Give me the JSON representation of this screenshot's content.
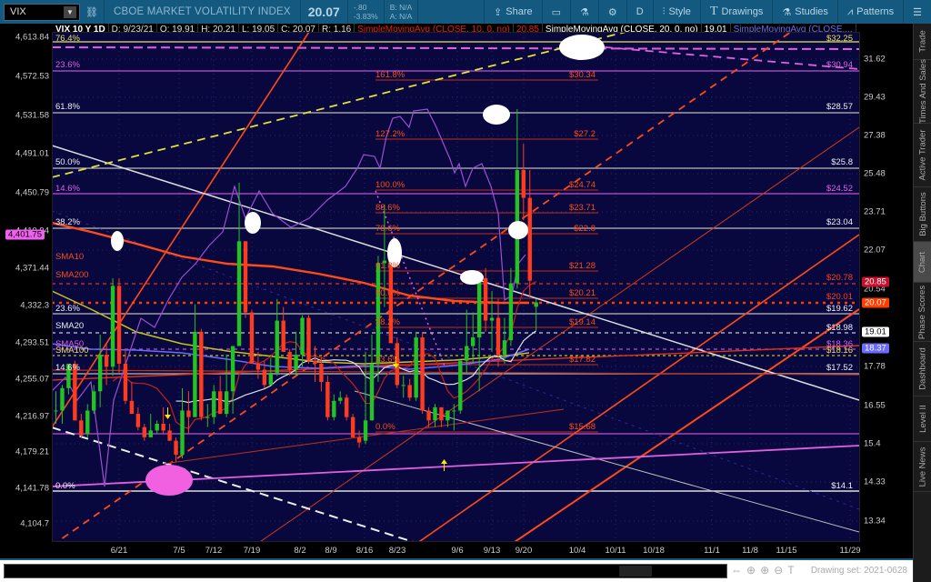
{
  "toolbar": {
    "symbol": "VIX",
    "title": "CBOE MARKET VOLATILITY INDEX",
    "last": "20.07",
    "change": "-.80",
    "change_pct": "-3.83%",
    "bid": "B: N/A",
    "ask": "A: N/A",
    "share": "Share",
    "period": "D",
    "style": "Style",
    "drawings": "Drawings",
    "studies": "Studies",
    "patterns": "Patterns"
  },
  "infobar": {
    "symbol_period": "VIX 10 Y 1D",
    "date": "D: 9/23/21",
    "open": "O: 19.91",
    "high": "H: 20.21",
    "low": "L: 19.05",
    "close": "C: 20.07",
    "range": "R: 1.16",
    "sma10_label": "SimpleMovingAvg (CLOSE, 10, 0, no)",
    "sma10_value": "20.85",
    "sma20_label": "SimpleMovingAvg (CLOSE, 20, 0, no)",
    "sma20_value": "19.01",
    "sma_other_label": "SimpleMovingAvg (CLOSE,..."
  },
  "left_axis": {
    "ticks": [
      "4,613.84",
      "4,572.53",
      "4,531.58",
      "4,491.01",
      "4,450.79",
      "4,410.94",
      "4,371.44",
      "4,332.3",
      "4,293.51",
      "4,255.07",
      "4,216.97",
      "4,179.21",
      "4,141.78",
      "4,104.7"
    ],
    "badge": "4,401.75"
  },
  "right_axis": {
    "ticks": [
      "31.62",
      "29.43",
      "27.38",
      "25.48",
      "23.71",
      "22.07",
      "20.54",
      "17.78",
      "16.55",
      "15.4",
      "14.33",
      "13.34"
    ],
    "badges": [
      {
        "value": "20.85",
        "color": "#c8102e"
      },
      {
        "value": "20.07",
        "color": "#ff3d00"
      },
      {
        "value": "19.01",
        "color": "#ffffff"
      },
      {
        "value": "18.37",
        "color": "#6a6aff"
      }
    ]
  },
  "left_fib_labels": [
    "76.4%",
    "23.6%",
    "61.8%",
    "50.0%",
    "14.6%",
    "38.2%",
    "SMA10",
    "SMA200",
    "23.6%",
    "SMA20",
    "SMA50",
    "SMA100",
    "14.6%",
    "0.0%"
  ],
  "mid_fib": {
    "pct": [
      "161.8%",
      "127.2%",
      "100.0%",
      "88.6%",
      "78.6%",
      "61.8%",
      "50.0%",
      "38.2%",
      "23.6%",
      "0.0%"
    ],
    "price": [
      "$30.34",
      "$27.2",
      "$24.74",
      "$23.71",
      "$22.8",
      "$21.28",
      "$20.21",
      "$19.14",
      "$17.82",
      "$15.68"
    ]
  },
  "right_levels": [
    "$32.25",
    "$30.94",
    "$28.57",
    "$25.8",
    "$24.52",
    "$23.04",
    "$20.78",
    "$20.01",
    "$19.62",
    "$18.98",
    "$18.36",
    "$18.16",
    "$17.52",
    "$14.1"
  ],
  "sidebar": {
    "tabs": [
      "Trade",
      "Times And Sales",
      "Active Trader",
      "Big Buttons",
      "Chart",
      "Phase Scores",
      "Dashboard",
      "Level II",
      "Live News"
    ],
    "active": "Chart"
  },
  "bottom": {
    "drawing_set": "Drawing set: 2021-0628"
  },
  "chart_data": {
    "type": "candlestick",
    "symbol": "VIX",
    "scale": "log",
    "ylim": [
      13.0,
      32.5
    ],
    "x_tick_labels": [
      "6/21",
      "7/5",
      "7/12",
      "7/19",
      "8/2",
      "8/9",
      "8/16",
      "8/23",
      "9/6",
      "9/13",
      "9/20",
      "10/4",
      "10/11",
      "10/18",
      "11/1",
      "11/8",
      "11/15",
      "11/29"
    ],
    "dates": [
      "6/7",
      "6/8",
      "6/9",
      "6/10",
      "6/11",
      "6/14",
      "6/15",
      "6/16",
      "6/17",
      "6/18",
      "6/21",
      "6/22",
      "6/23",
      "6/24",
      "6/25",
      "6/28",
      "6/29",
      "6/30",
      "7/1",
      "7/2",
      "7/6",
      "7/7",
      "7/8",
      "7/9",
      "7/12",
      "7/13",
      "7/14",
      "7/15",
      "7/16",
      "7/19",
      "7/20",
      "7/21",
      "7/22",
      "7/23",
      "7/26",
      "7/27",
      "7/28",
      "7/29",
      "7/30",
      "8/2",
      "8/3",
      "8/4",
      "8/5",
      "8/6",
      "8/9",
      "8/10",
      "8/11",
      "8/12",
      "8/13",
      "8/16",
      "8/17",
      "8/18",
      "8/19",
      "8/20",
      "8/23",
      "8/24",
      "8/25",
      "8/26",
      "8/27",
      "8/30",
      "8/31",
      "9/1",
      "9/2",
      "9/3",
      "9/7",
      "9/8",
      "9/9",
      "9/10",
      "9/13",
      "9/14",
      "9/15",
      "9/16",
      "9/17",
      "9/20",
      "9/21",
      "9/22",
      "9/23"
    ],
    "ohlc": [
      [
        16.4,
        17.0,
        16.0,
        16.4
      ],
      [
        16.4,
        17.2,
        16.0,
        17.1
      ],
      [
        17.1,
        17.9,
        16.9,
        17.9
      ],
      [
        17.9,
        18.0,
        16.1,
        16.1
      ],
      [
        16.1,
        16.3,
        15.6,
        15.65
      ],
      [
        15.7,
        16.6,
        15.6,
        16.4
      ],
      [
        16.4,
        17.2,
        16.3,
        17.0
      ],
      [
        17.0,
        18.9,
        16.5,
        18.2
      ],
      [
        18.2,
        18.6,
        17.2,
        17.8
      ],
      [
        17.8,
        21.0,
        17.5,
        20.7
      ],
      [
        20.7,
        21.0,
        17.6,
        17.9
      ],
      [
        17.9,
        18.4,
        16.6,
        16.7
      ],
      [
        16.7,
        17.3,
        16.3,
        16.3
      ],
      [
        16.3,
        16.5,
        15.8,
        15.9
      ],
      [
        15.9,
        16.0,
        15.5,
        15.6
      ],
      [
        15.6,
        16.3,
        15.6,
        15.8
      ],
      [
        15.8,
        16.1,
        15.7,
        16.0
      ],
      [
        16.0,
        16.5,
        15.7,
        15.8
      ],
      [
        15.8,
        16.0,
        15.5,
        15.5
      ],
      [
        15.5,
        15.6,
        14.9,
        15.1
      ],
      [
        15.1,
        17.1,
        15.0,
        16.4
      ],
      [
        16.4,
        17.0,
        15.7,
        16.2
      ],
      [
        16.2,
        20.0,
        16.2,
        19.0
      ],
      [
        19.0,
        19.1,
        16.1,
        16.2
      ],
      [
        16.2,
        16.6,
        15.9,
        16.2
      ],
      [
        16.2,
        17.2,
        16.0,
        17.0
      ],
      [
        17.0,
        17.5,
        16.3,
        16.3
      ],
      [
        16.3,
        18.2,
        16.2,
        17.0
      ],
      [
        17.0,
        18.5,
        16.3,
        18.5
      ],
      [
        18.5,
        25.1,
        18.5,
        22.5
      ],
      [
        22.5,
        22.5,
        19.5,
        19.7
      ],
      [
        19.7,
        19.8,
        17.9,
        17.9
      ],
      [
        17.9,
        18.3,
        17.4,
        17.7
      ],
      [
        17.7,
        18.0,
        17.1,
        17.2
      ],
      [
        17.2,
        18.1,
        17.2,
        17.6
      ],
      [
        17.6,
        20.2,
        17.5,
        19.4
      ],
      [
        19.4,
        19.9,
        18.3,
        18.3
      ],
      [
        18.3,
        18.4,
        17.5,
        17.7
      ],
      [
        17.7,
        19.0,
        17.5,
        18.2
      ],
      [
        18.2,
        19.6,
        17.8,
        19.5
      ],
      [
        19.5,
        19.6,
        17.9,
        18.0
      ],
      [
        18.0,
        18.5,
        17.3,
        17.9
      ],
      [
        17.9,
        18.1,
        17.0,
        17.3
      ],
      [
        17.3,
        17.5,
        16.1,
        16.2
      ],
      [
        16.2,
        16.9,
        16.1,
        16.7
      ],
      [
        16.7,
        17.0,
        16.6,
        16.8
      ],
      [
        16.8,
        16.9,
        16.1,
        16.2
      ],
      [
        16.2,
        16.3,
        15.6,
        15.6
      ],
      [
        15.6,
        15.8,
        15.3,
        15.45
      ],
      [
        15.5,
        18.3,
        15.4,
        16.1
      ],
      [
        16.1,
        18.9,
        16.1,
        17.9
      ],
      [
        17.9,
        21.9,
        17.3,
        21.6
      ],
      [
        21.6,
        24.1,
        19.9,
        21.7
      ],
      [
        21.7,
        21.8,
        18.6,
        18.6
      ],
      [
        18.6,
        18.8,
        17.1,
        17.2
      ],
      [
        17.2,
        17.5,
        16.8,
        17.2
      ],
      [
        17.2,
        17.4,
        16.7,
        16.8
      ],
      [
        16.8,
        19.0,
        16.7,
        18.8
      ],
      [
        18.8,
        19.0,
        16.3,
        16.4
      ],
      [
        16.4,
        16.5,
        15.9,
        16.1
      ],
      [
        16.1,
        16.6,
        15.9,
        16.5
      ],
      [
        16.5,
        16.5,
        15.9,
        16.1
      ],
      [
        16.1,
        16.4,
        15.9,
        16.4
      ],
      [
        16.4,
        16.6,
        15.8,
        16.4
      ],
      [
        16.4,
        18.0,
        16.3,
        18.0
      ],
      [
        18.0,
        19.8,
        17.6,
        18.5
      ],
      [
        18.5,
        19.7,
        17.9,
        18.8
      ],
      [
        18.8,
        21.0,
        17.0,
        21.0
      ],
      [
        21.0,
        21.4,
        19.0,
        19.4
      ],
      [
        19.4,
        20.5,
        18.3,
        19.5
      ],
      [
        19.5,
        20.2,
        17.8,
        18.2
      ],
      [
        18.2,
        19.5,
        17.9,
        18.7
      ],
      [
        18.7,
        21.4,
        18.5,
        20.8
      ],
      [
        20.8,
        28.8,
        20.6,
        25.7
      ],
      [
        25.7,
        27.0,
        23.4,
        24.4
      ],
      [
        24.4,
        25.7,
        20.3,
        20.9
      ],
      [
        19.91,
        20.21,
        19.05,
        20.07
      ]
    ],
    "colors": {
      "up": "#22c322",
      "down": "#ff3b1f",
      "sma10": "#c8201a",
      "sma20": "#dddddd"
    }
  }
}
